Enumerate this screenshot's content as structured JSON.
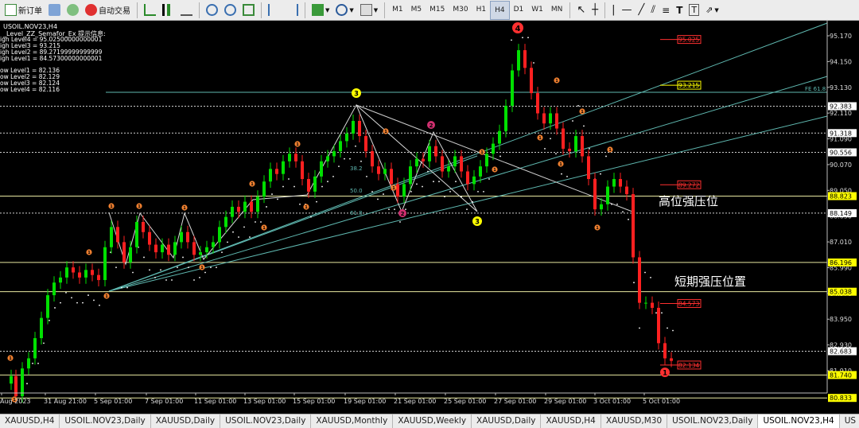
{
  "toolbar": {
    "new_order": "新订单",
    "auto_trade": "自动交易",
    "timeframes": [
      "M1",
      "M5",
      "M15",
      "M30",
      "H1",
      "H4",
      "D1",
      "W1",
      "MN"
    ],
    "active_timeframe": "H4"
  },
  "chart": {
    "symbol_title": "USOIL.NOV23,H4",
    "indicator_title": "_Level_ZZ_Semafor_Ex 提示信息:",
    "high_levels": [
      "igh Level4 = 95.02500000000001",
      "igh Level3 = 93.215",
      "igh Level2 = 89.27199999999999",
      "igh Level1 = 84.57300000000001"
    ],
    "low_levels": [
      "ow Level1 = 82.136",
      "ow Level2 = 82.129",
      "ow Level3 = 82.124",
      "ow Level4 = 82.116"
    ],
    "annotations": {
      "high_resistance": "高位强压位",
      "short_resistance": "短期强压位置",
      "fe": "FE 61.8"
    },
    "fib_labels": [
      "38.2",
      "50.0",
      "61.8"
    ],
    "price_axis": [
      "95.170",
      "94.150",
      "93.130",
      "92.110",
      "91.090",
      "90.070",
      "89.050",
      "88.030",
      "87.010",
      "85.990",
      "84.970",
      "83.950",
      "82.930",
      "81.910"
    ],
    "price_tags": [
      {
        "price": "92.383",
        "color": "#ffffff"
      },
      {
        "price": "91.318",
        "color": "#ffffff"
      },
      {
        "price": "90.556",
        "color": "#ffffff"
      },
      {
        "price": "88.823",
        "color": "#ffff00"
      },
      {
        "price": "88.149",
        "color": "#ffffff"
      },
      {
        "price": "86.196",
        "color": "#ffff00"
      },
      {
        "price": "85.038",
        "color": "#ffff00"
      },
      {
        "price": "82.683",
        "color": "#ffffff"
      },
      {
        "price": "81.740",
        "color": "#ffff00"
      },
      {
        "price": "80.833",
        "color": "#ffff00"
      }
    ],
    "level_marks": [
      {
        "price": "95.025",
        "color": "#ff3030"
      },
      {
        "price": "93.215",
        "color": "#ffff00"
      },
      {
        "price": "89.272",
        "color": "#ff3030"
      },
      {
        "price": "84.573",
        "color": "#ff3030"
      },
      {
        "price": "82.134",
        "color": "#ff3030"
      }
    ],
    "time_axis": [
      "Aug 2023",
      "31 Aug 21:00",
      "5 Sep 01:00",
      "7 Sep 01:00",
      "11 Sep 01:00",
      "13 Sep 01:00",
      "15 Sep 01:00",
      "19 Sep 01:00",
      "21 Sep 01:00",
      "25 Sep 01:00",
      "27 Sep 01:00",
      "29 Sep 01:00",
      "3 Oct 01:00",
      "5 Oct 01:00"
    ],
    "semafor_labels": {
      "big_3_a": "3",
      "big_3_b": "3",
      "big_4": "4",
      "big_2": "2",
      "small_1": "1",
      "small_2": "2"
    },
    "colors": {
      "bull": "#00e000",
      "bear": "#ff2020",
      "grid": "#3a3a3a",
      "level_line": "#e8e8c0",
      "trend": "#5fb8b0"
    }
  },
  "tabs": [
    "XAUUSD,H4",
    "USOIL.NOV23,Daily",
    "XAUUSD,Daily",
    "USOIL.NOV23,Daily",
    "XAUUSD,Monthly",
    "XAUUSD,Weekly",
    "XAUUSD,Daily",
    "XAUUSD,H4",
    "XAUUSD,M30",
    "USOIL.NOV23,Daily",
    "USOIL.NOV23,H4",
    "US"
  ],
  "active_tab": "USOIL.NOV23,H4"
}
